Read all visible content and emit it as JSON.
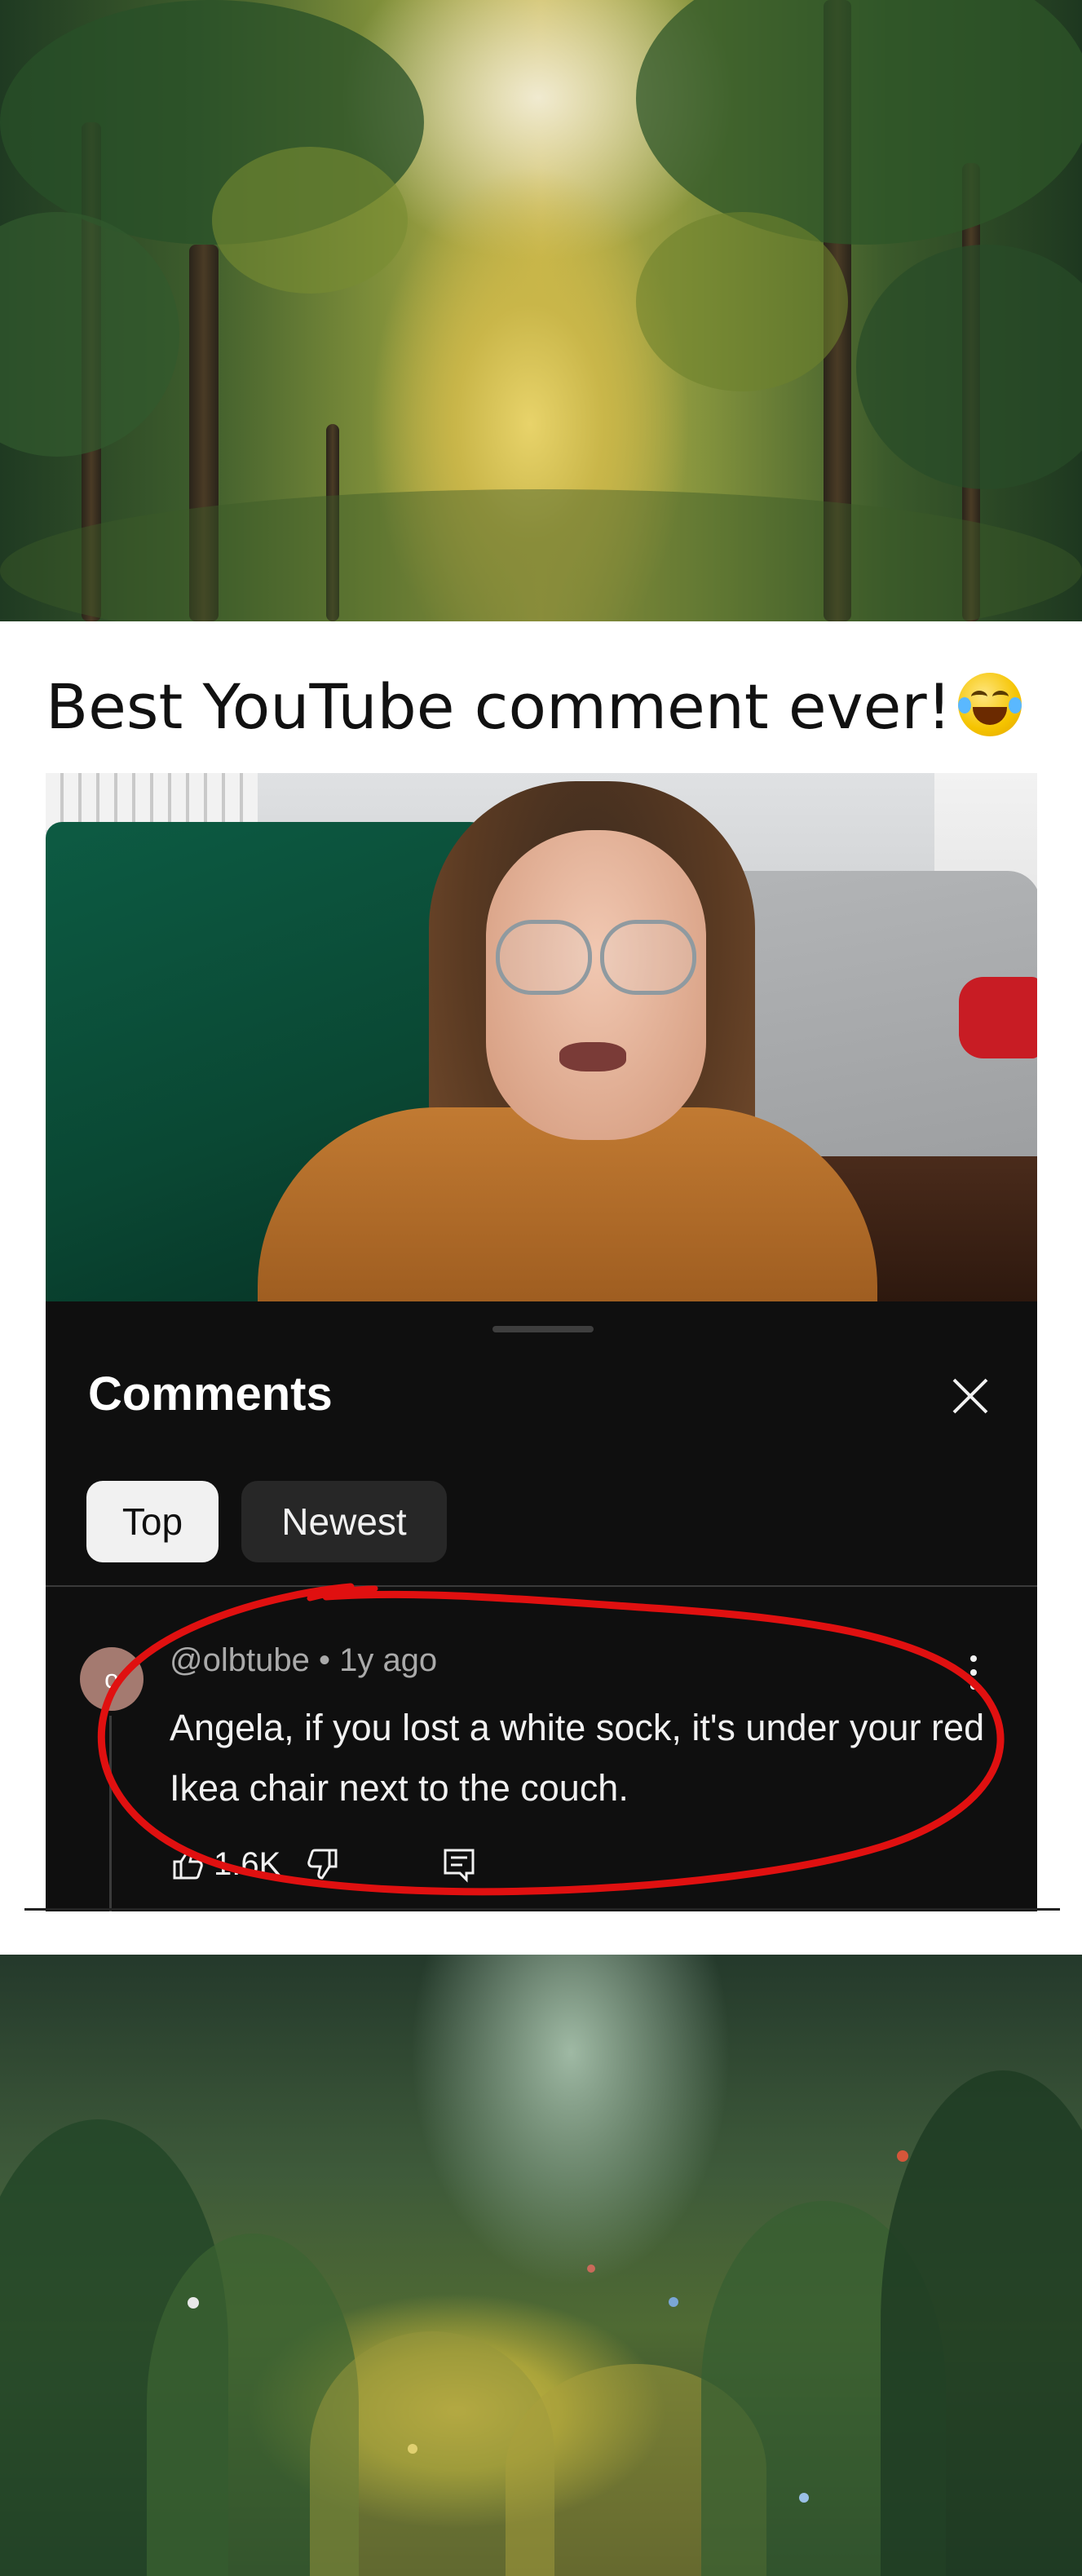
{
  "title": {
    "text": "Best YouTube comment ever!",
    "emoji": "face-with-tears-of-joy-icon"
  },
  "comments_panel": {
    "heading": "Comments",
    "tabs": [
      {
        "label": "Top",
        "selected": true
      },
      {
        "label": "Newest",
        "selected": false
      }
    ],
    "comment": {
      "avatar_letter": "o",
      "author": "@olbtube",
      "separator": " • ",
      "time": "1y ago",
      "text": "Angela, if you lost a white sock, it's under your red Ikea chair next to the couch.",
      "likes": "1.6K"
    }
  },
  "colors": {
    "panel_bg": "#0f0f0f",
    "chip_active": "#f1f1f1",
    "chip_inactive": "#272727",
    "annotation": "#e01010"
  }
}
